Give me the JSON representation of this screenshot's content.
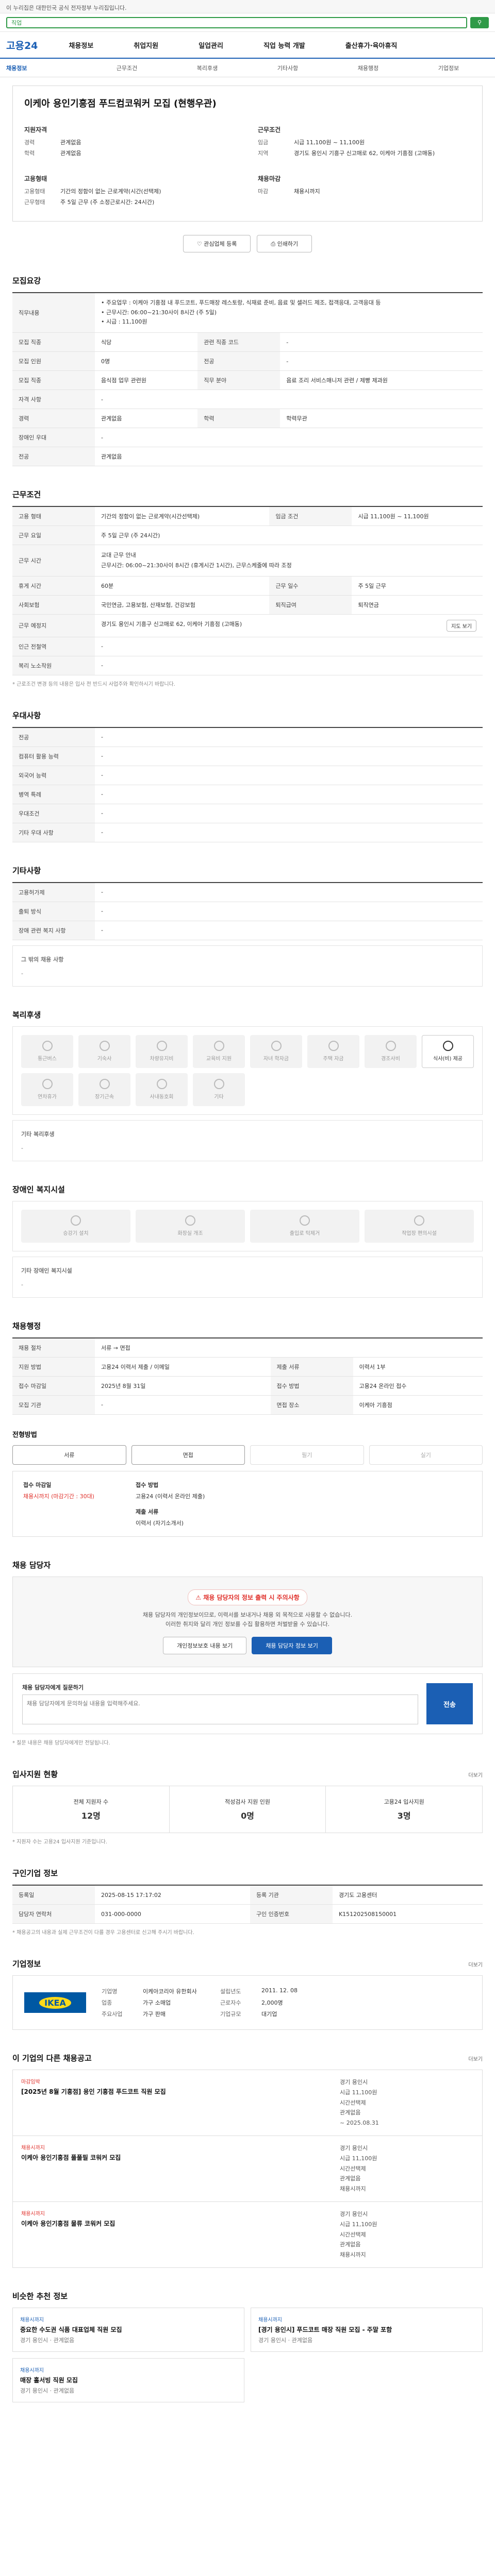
{
  "gov_banner": "이 누리집은 대한민국 공식 전자정부 누리집입니다.",
  "search": {
    "placeholder": "직업"
  },
  "header": {
    "logo": "고용24",
    "nav": [
      "채용정보",
      "취업지원",
      "일업관리",
      "직업 능력 개발",
      "출산휴가·육아휴직"
    ]
  },
  "tabs": [
    "채용정보",
    "근무조건",
    "복리후생",
    "기타사항",
    "채용행정",
    "기업정보"
  ],
  "title_box": {
    "title": "이케아 용인기흥점 푸드컴코워커 모집 (현행우관)",
    "left": {
      "heading": "지원자격",
      "rows": [
        {
          "k": "경력",
          "v": "관계없음"
        },
        {
          "k": "학력",
          "v": "관계없음"
        }
      ],
      "heading2": "고용형태",
      "rows2": [
        {
          "k": "고용형태",
          "v": "기간의 정함이 없는 근로계약(시간(선택제)"
        },
        {
          "k": "근무형태",
          "v": "주 5일 근무 (주 소정근로시간: 24시간)"
        }
      ]
    },
    "right": {
      "heading": "근무조건",
      "rows": [
        {
          "k": "임금",
          "v": "시급 11,100원 ~ 11,100원"
        },
        {
          "k": "지역",
          "v": "경기도 용인시 기흥구 신고매로 62, 이케아 기흥점 (고매동)"
        }
      ],
      "heading2": "채용마감",
      "rows2": [
        {
          "k": "마감",
          "v": "채용시까지"
        }
      ]
    },
    "btn_scrap": "관심업체 등록",
    "btn_print": "인쇄하기"
  },
  "recruit": {
    "heading": "모집요강",
    "duty_label": "직무내용",
    "duty_text": "• 주요업무 : 이케아 기흥점 내 푸드코트, 푸드매장 레스토랑, 식재료 준비, 음료 및 셀러드 제조, 접객응대, 고객응대 등\n• 근무시간: 06:00~21:30사이 8시간 (주 5일)\n• 시급 : 11,100원",
    "rows": [
      {
        "k1": "모집 직종",
        "v1": "식당",
        "k2": "관련 직종 코드",
        "v2": "-"
      },
      {
        "k1": "모집 인원",
        "v1": "0명",
        "k2": "전공",
        "v2": "-"
      },
      {
        "k1": "모집 직종",
        "v1": "음식점 업무 관련원",
        "k2": "직무 분야",
        "v2": "음료 조리 서비스매니저 관련 / 제빵 제과원"
      },
      {
        "k1": "자격 사항",
        "v1": "-",
        "k2": "",
        "v2": ""
      },
      {
        "k1": "경력",
        "v1": "관계없음",
        "k2": "학력",
        "v2": "학력무관"
      },
      {
        "k1": "장애인 우대",
        "v1": "-",
        "k2": "",
        "v2": ""
      },
      {
        "k1": "전공",
        "v1": "관계없음",
        "k2": "",
        "v2": ""
      }
    ]
  },
  "conditions": {
    "heading": "근무조건",
    "rows": [
      {
        "k1": "고용 형태",
        "v1": "기간의 정함이 없는 근로계약(시간선택제)",
        "k2": "임금 조건",
        "v2": "시급 11,100원 ~ 11,100원"
      }
    ],
    "work_days_label": "근무 요일",
    "work_days": "주 5일 근무 (주 24시간)",
    "work_time_label": "근무 시간",
    "work_time": "교대 근무 안내\n근무시간: 06:00~21:30사이 8시간 (휴게시간 1시간), 근무스케줄에 따라 조정",
    "rows2": [
      {
        "k1": "휴게 시간",
        "v1": "60분",
        "k2": "근무 일수",
        "v2": "주 5일 근무"
      },
      {
        "k1": "사회보험",
        "v1": "국민연금, 고용보험, 산재보험, 건강보험",
        "k2": "퇴직급여",
        "v2": "퇴직연금"
      },
      {
        "k1": "근무 예정지",
        "v1": "경기도 용인시 기흥구 신고매로 62, 이케아 기흥점 (고매동)",
        "k2": "",
        "v2": ""
      },
      {
        "k1": "인근 전철역",
        "v1": "-",
        "k2": "",
        "v2": ""
      },
      {
        "k1": "복리 노소작원",
        "v1": "-",
        "k2": "",
        "v2": ""
      }
    ],
    "map_label": "지도 보기",
    "note": "* 근로조건 변경 등의 내용은 입사 전 반드시 사업주와 확인하시기 바랍니다."
  },
  "preference": {
    "heading": "우대사항",
    "rows": [
      {
        "k": "전공",
        "v": "-"
      },
      {
        "k": "컴퓨터 활용 능력",
        "v": "-"
      },
      {
        "k": "외국어 능력",
        "v": "-"
      },
      {
        "k": "병역 특례",
        "v": "-"
      },
      {
        "k": "우대조건",
        "v": "-"
      },
      {
        "k": "기타 우대 사항",
        "v": "-"
      }
    ]
  },
  "etc": {
    "heading": "기타사항",
    "rows": [
      {
        "k": "고용허가제",
        "v": "-"
      },
      {
        "k": "출퇴 방식",
        "v": "-"
      },
      {
        "k": "장애 관련 복지 사항",
        "v": "-"
      }
    ],
    "other_label": "그 밖의 채용 사항",
    "other_value": "-"
  },
  "welfare": {
    "heading": "복리후생",
    "items": [
      "통근버스",
      "기숙사",
      "차량유지비",
      "교육비 지원",
      "자녀 학자금",
      "주택 자금",
      "경조사비",
      "식사(비) 제공",
      "연차휴가",
      "장기근속",
      "사내동호회",
      "기타"
    ],
    "active": "식사(비) 제공",
    "other_label": "기타 복리후생",
    "other_value": "-"
  },
  "disability": {
    "heading": "장애인 복지시설",
    "items": [
      "승강기 설치",
      "화장실 개조",
      "출입로 턱제거",
      "작업장 편의시설"
    ],
    "other_label": "기타 장애인 복지시설",
    "other_value": "-"
  },
  "process": {
    "heading": "채용행정",
    "rows": [
      {
        "k1": "채용 절차",
        "v1": "서류 → 면접",
        "k2": "",
        "v2": ""
      },
      {
        "k1": "지원 방법",
        "v1": "고용24 이력서 제출 / 이메일",
        "k2": "제출 서류",
        "v2": "이력서 1부"
      },
      {
        "k1": "접수 마감일",
        "v1": "2025년 8월 31일",
        "k2": "접수 방법",
        "v2": "고용24 온라인 접수"
      },
      {
        "k1": "모집 기관",
        "v1": "-",
        "k2": "면접 장소",
        "v2": "이케아 기흥점"
      }
    ],
    "steps_label": "전형방법",
    "steps": [
      "서류",
      "면접",
      "필기",
      "실기"
    ],
    "active_steps": [
      "서류",
      "면접"
    ]
  },
  "apply": {
    "deadline_label": "접수 마감일",
    "deadline": "채용시까지 (마감기간 : 30대)",
    "method_label": "접수 방법",
    "method": "고용24 (이력서 온라인 제출)",
    "doc_label": "제출 서류",
    "doc": "이력서 (자기소개서)"
  },
  "contact": {
    "heading": "채용 담당자",
    "alert": "채용 담당자의 정보 출력 시 주의사항",
    "desc": "채용 담당자의 개인정보이므로, 이력서를 보내거나 채용 외 목적으로 사용할 수 없습니다.\n이러한 취지와 달리 개인 정보를 수집 활용하면 처벌받을 수 있습니다.",
    "btn_info": "개인정보보호 내용 보기",
    "btn_show": "채용 담당자 정보 보기",
    "qna_label": "채용 담당자에게 질문하기",
    "qna_placeholder": "채용 담당자에게 문의하실 내용을 입력해주세요.",
    "qna_send": "전송",
    "qna_note": "* 질문 내용은 채용 담당자에게만 전달됩니다."
  },
  "status": {
    "heading": "입사지원 현황",
    "cells": [
      {
        "label": "전체 지원자 수",
        "value": "12명"
      },
      {
        "label": "적성검사 지원 인원",
        "value": "0명"
      },
      {
        "label": "고용24 입사지원",
        "value": "3명"
      }
    ],
    "note": "* 지원자 수는 고용24 입사지원 기준입니다."
  },
  "post_info": {
    "heading": "구인기업 정보",
    "rows": [
      {
        "k1": "등록일",
        "v1": "2025-08-15 17:17:02",
        "k2": "등록 기관",
        "v2": "경기도 고용센터"
      },
      {
        "k1": "담당자 연락처",
        "v1": "031-000-0000",
        "k2": "구인 인증번호",
        "v2": "K151202508150001"
      }
    ],
    "note": "* 채용공고의 내용과 실제 근무조건이 다를 경우 고용센터로 신고해 주시기 바랍니다."
  },
  "company": {
    "heading": "기업정보",
    "logo": "IKEA",
    "rows": [
      {
        "k1": "기업명",
        "v1": "이케아코리아 유한회사",
        "k2": "설립년도",
        "v2": "2011. 12. 08"
      },
      {
        "k1": "업종",
        "v1": "가구 소매업",
        "k2": "근로자수",
        "v2": "2,000명"
      },
      {
        "k1": "주요사업",
        "v1": "가구 판매",
        "k2": "기업규모",
        "v2": "대기업"
      }
    ]
  },
  "same_company_jobs": {
    "heading": "이 기업의 다른 채용공고",
    "jobs": [
      {
        "tag": "마감임박",
        "title": "[2025년 8월 기흥점] 용인 기흥점 푸드코트 직원 모집",
        "loc": "경기 용인시",
        "pay": "시급 11,100원",
        "type": "시간선택제",
        "career": "관계없음",
        "deadline": "~ 2025.08.31"
      },
      {
        "tag": "채용시까지",
        "title": "이케아 용인기흥점 풀풀필 코워커 모집",
        "loc": "경기 용인시",
        "pay": "시급 11,100원",
        "type": "시간선택제",
        "career": "관계없음",
        "deadline": "채용시까지"
      },
      {
        "tag": "채용시까지",
        "title": "이케아 용인기흥점 물류 코워커 모집",
        "loc": "경기 용인시",
        "pay": "시급 11,100원",
        "type": "시간선택제",
        "career": "관계없음",
        "deadline": "채용시까지"
      }
    ]
  },
  "recommended": {
    "heading": "비슷한 추천 정보",
    "items": [
      {
        "tag": "채용시까지",
        "title": "중요한 수도권 식품 대표업체 직원 모집",
        "info": "경기 용인시 · 관계없음"
      },
      {
        "tag": "채용시까지",
        "title": "[경기 용인시] 푸드코트 매장 직원 모집 - 주말 포함",
        "info": "경기 용인시 · 관계없음"
      },
      {
        "tag": "채용시까지",
        "title": "매장 홀서빙 직원 모집",
        "info": "경기 용인시 · 관계없음"
      }
    ]
  },
  "more_label": "더보기"
}
